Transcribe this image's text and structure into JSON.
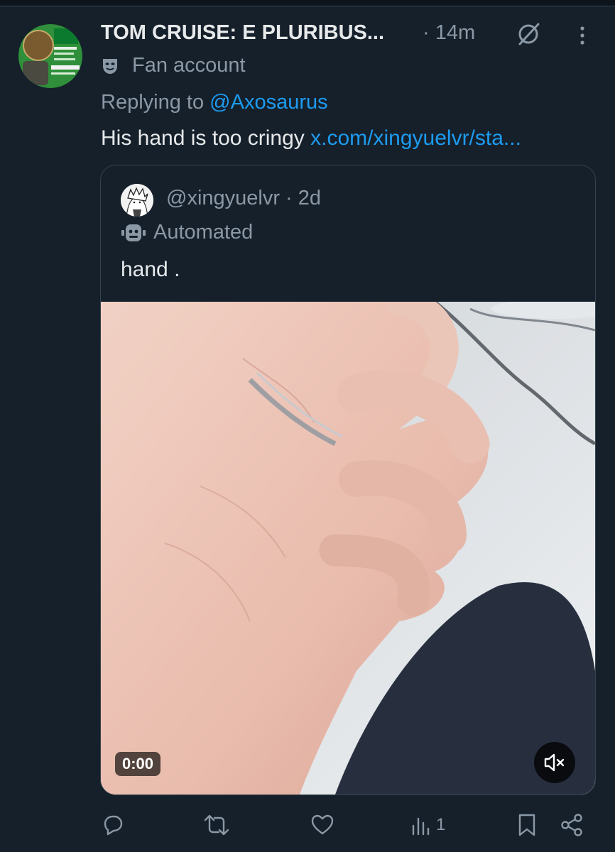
{
  "tweet": {
    "author_name": "TOM CRUISE: E PLURIBUS...",
    "time": "· 14m",
    "label": "Fan account",
    "replying_prefix": "Replying to",
    "replying_handle": "@Axosaurus",
    "text": "His hand is too cringy",
    "link": "x.com/xingyuelvr/sta..."
  },
  "quote": {
    "handle_time": "@xingyuelvr · 2d",
    "label": "Automated",
    "text": "hand .",
    "video_time": "0:00"
  },
  "actions": {
    "views_count": "1"
  },
  "colors": {
    "background": "#15202b",
    "accent": "#1d9bf0",
    "muted": "#8b98a5",
    "border": "#38444d"
  },
  "icons": [
    "grok-icon",
    "more-icon",
    "theater-mask-icon",
    "robot-icon",
    "mute-icon",
    "reply-icon",
    "retweet-icon",
    "like-icon",
    "views-icon",
    "bookmark-icon",
    "share-icon"
  ]
}
